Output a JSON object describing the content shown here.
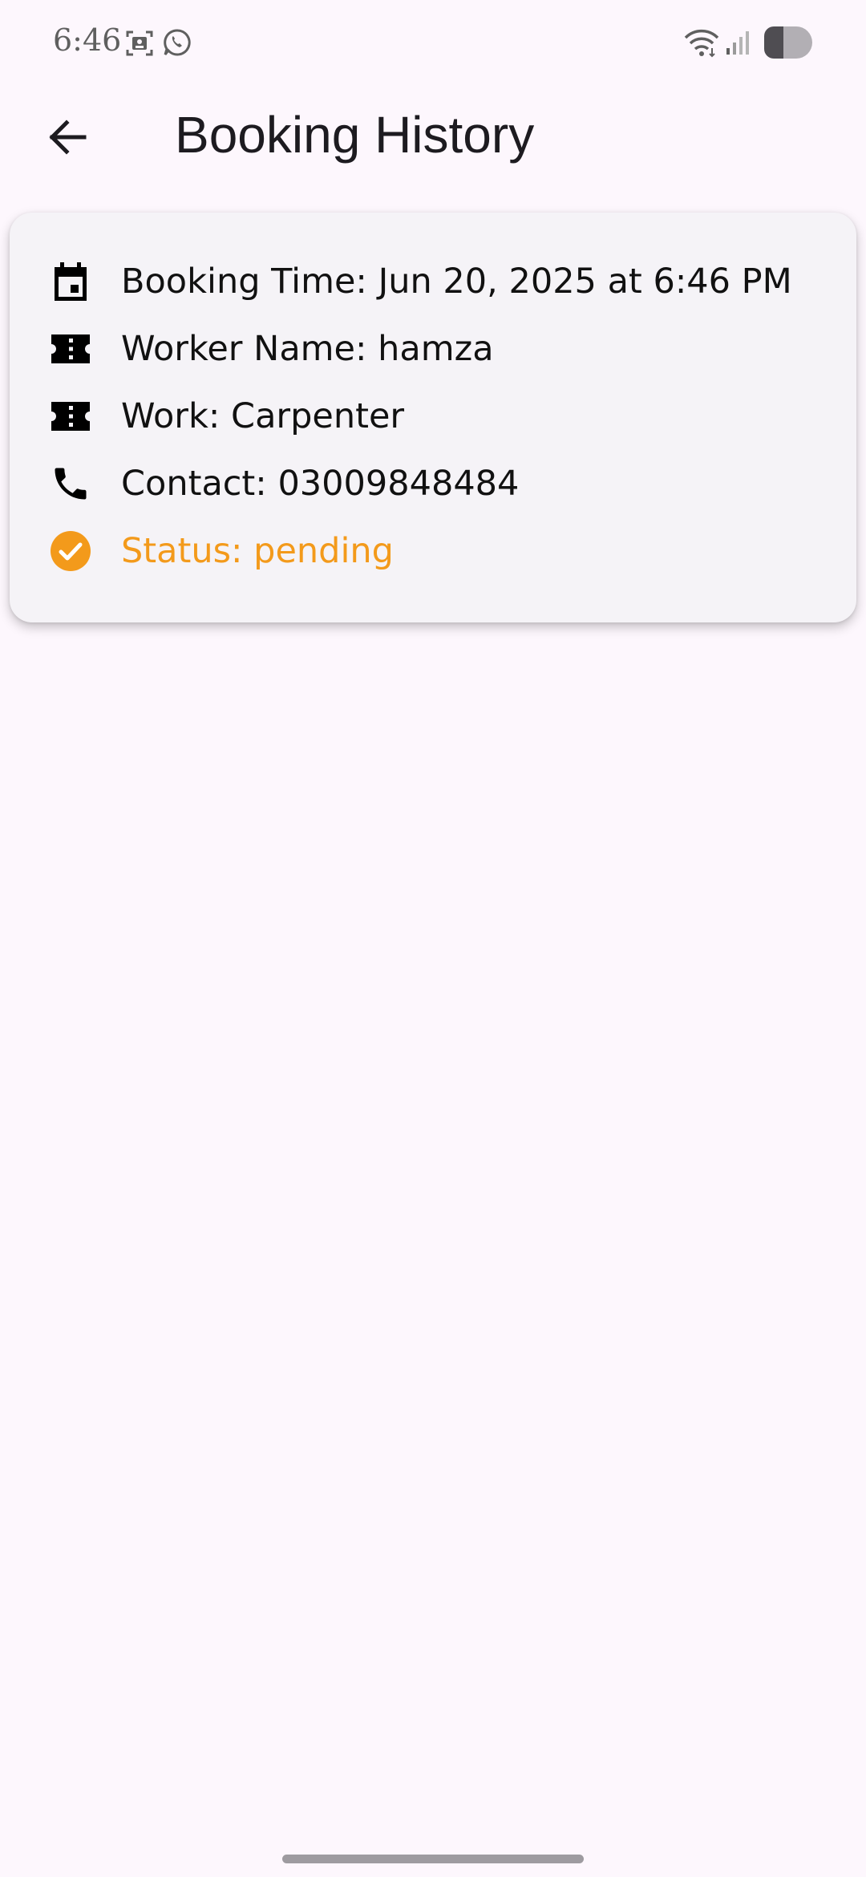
{
  "status_bar": {
    "time": "6:46",
    "left_icons": [
      "screen-record-icon",
      "whatsapp-icon"
    ],
    "right_icons": [
      "wifi-icon",
      "cell-signal-icon",
      "battery-icon"
    ]
  },
  "app_bar": {
    "back_icon": "arrow-back-icon",
    "title": "Booking History"
  },
  "booking": {
    "booking_time": "Booking Time: Jun 20, 2025 at 6:46 PM",
    "worker_name": "Worker Name: hamza",
    "work": "Work: Carpenter",
    "contact": "Contact: 03009848484",
    "status": "Status: pending",
    "status_color": "#f39a1b"
  }
}
